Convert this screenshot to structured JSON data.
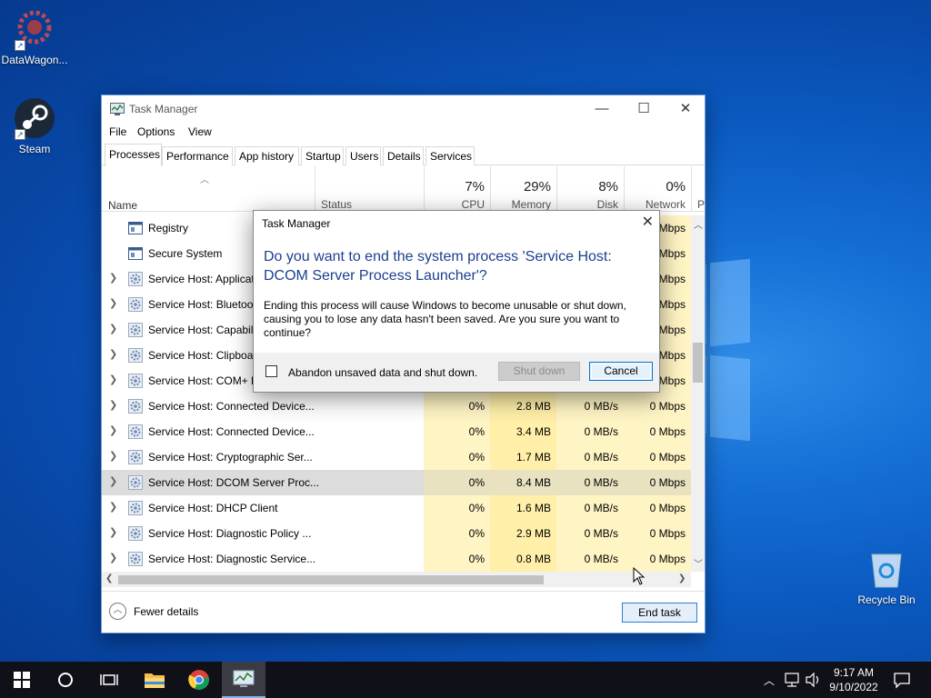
{
  "desktop": {
    "icons": [
      {
        "label": "DataWagon..."
      },
      {
        "label": "Steam"
      },
      {
        "label": "Recycle Bin"
      }
    ]
  },
  "task_manager": {
    "title": "Task Manager",
    "menu": [
      "File",
      "Options",
      "View"
    ],
    "tabs": [
      "Processes",
      "Performance",
      "App history",
      "Startup",
      "Users",
      "Details",
      "Services"
    ],
    "active_tab": "Processes",
    "columns": {
      "name": "Name",
      "status": "Status",
      "cpu": {
        "pct": "7%",
        "label": "CPU"
      },
      "memory": {
        "pct": "29%",
        "label": "Memory"
      },
      "disk": {
        "pct": "8%",
        "label": "Disk"
      },
      "network": {
        "pct": "0%",
        "label": "Network"
      },
      "power_partial": "P"
    },
    "rows": [
      {
        "name": "Registry",
        "cpu": "",
        "mem": "",
        "disk": "",
        "net": "Mbps",
        "expandable": false
      },
      {
        "name": "Secure System",
        "cpu": "",
        "mem": "",
        "disk": "",
        "net": "Mbps",
        "expandable": false
      },
      {
        "name": "Service Host: Applicat",
        "cpu": "",
        "mem": "",
        "disk": "",
        "net": "Mbps",
        "expandable": true
      },
      {
        "name": "Service Host: Bluetoot",
        "cpu": "",
        "mem": "",
        "disk": "",
        "net": "Mbps",
        "expandable": true
      },
      {
        "name": "Service Host: Capabili",
        "cpu": "",
        "mem": "",
        "disk": "",
        "net": "Mbps",
        "expandable": true
      },
      {
        "name": "Service Host: Clipboar",
        "cpu": "",
        "mem": "",
        "disk": "",
        "net": "Mbps",
        "expandable": true
      },
      {
        "name": "Service Host: COM+ E",
        "cpu": "",
        "mem": "",
        "disk": "",
        "net": "Mbps",
        "expandable": true
      },
      {
        "name": "Service Host: Connected Device...",
        "cpu": "0%",
        "mem": "2.8 MB",
        "disk": "0 MB/s",
        "net": "0 Mbps",
        "expandable": true
      },
      {
        "name": "Service Host: Connected Device...",
        "cpu": "0%",
        "mem": "3.4 MB",
        "disk": "0 MB/s",
        "net": "0 Mbps",
        "expandable": true
      },
      {
        "name": "Service Host: Cryptographic Ser...",
        "cpu": "0%",
        "mem": "1.7 MB",
        "disk": "0 MB/s",
        "net": "0 Mbps",
        "expandable": true
      },
      {
        "name": "Service Host: DCOM Server Proc...",
        "cpu": "0%",
        "mem": "8.4 MB",
        "disk": "0 MB/s",
        "net": "0 Mbps",
        "expandable": true,
        "selected": true
      },
      {
        "name": "Service Host: DHCP Client",
        "cpu": "0%",
        "mem": "1.6 MB",
        "disk": "0 MB/s",
        "net": "0 Mbps",
        "expandable": true
      },
      {
        "name": "Service Host: Diagnostic Policy ...",
        "cpu": "0%",
        "mem": "2.9 MB",
        "disk": "0 MB/s",
        "net": "0 Mbps",
        "expandable": true
      },
      {
        "name": "Service Host: Diagnostic Service...",
        "cpu": "0%",
        "mem": "0.8 MB",
        "disk": "0 MB/s",
        "net": "0 Mbps",
        "expandable": true
      }
    ],
    "fewer_details": "Fewer details",
    "end_task": "End task"
  },
  "dialog": {
    "title": "Task Manager",
    "question": "Do you want to end the system process 'Service Host: DCOM Server Process Launcher'?",
    "body": "Ending this process will cause Windows to become unusable or shut down, causing you to lose any data hasn't been saved. Are you sure you want to continue?",
    "checkbox_label": "Abandon unsaved data and shut down.",
    "checkbox_checked": false,
    "shutdown_label": "Shut down",
    "cancel_label": "Cancel"
  },
  "taskbar": {
    "time": "9:17 AM",
    "date": "9/10/2022"
  },
  "colors": {
    "accent": "#0078d7",
    "dialog_question": "#1b3f8f",
    "cpu_heat": "#fff4c4",
    "mem_heat": "#ffefa8"
  }
}
